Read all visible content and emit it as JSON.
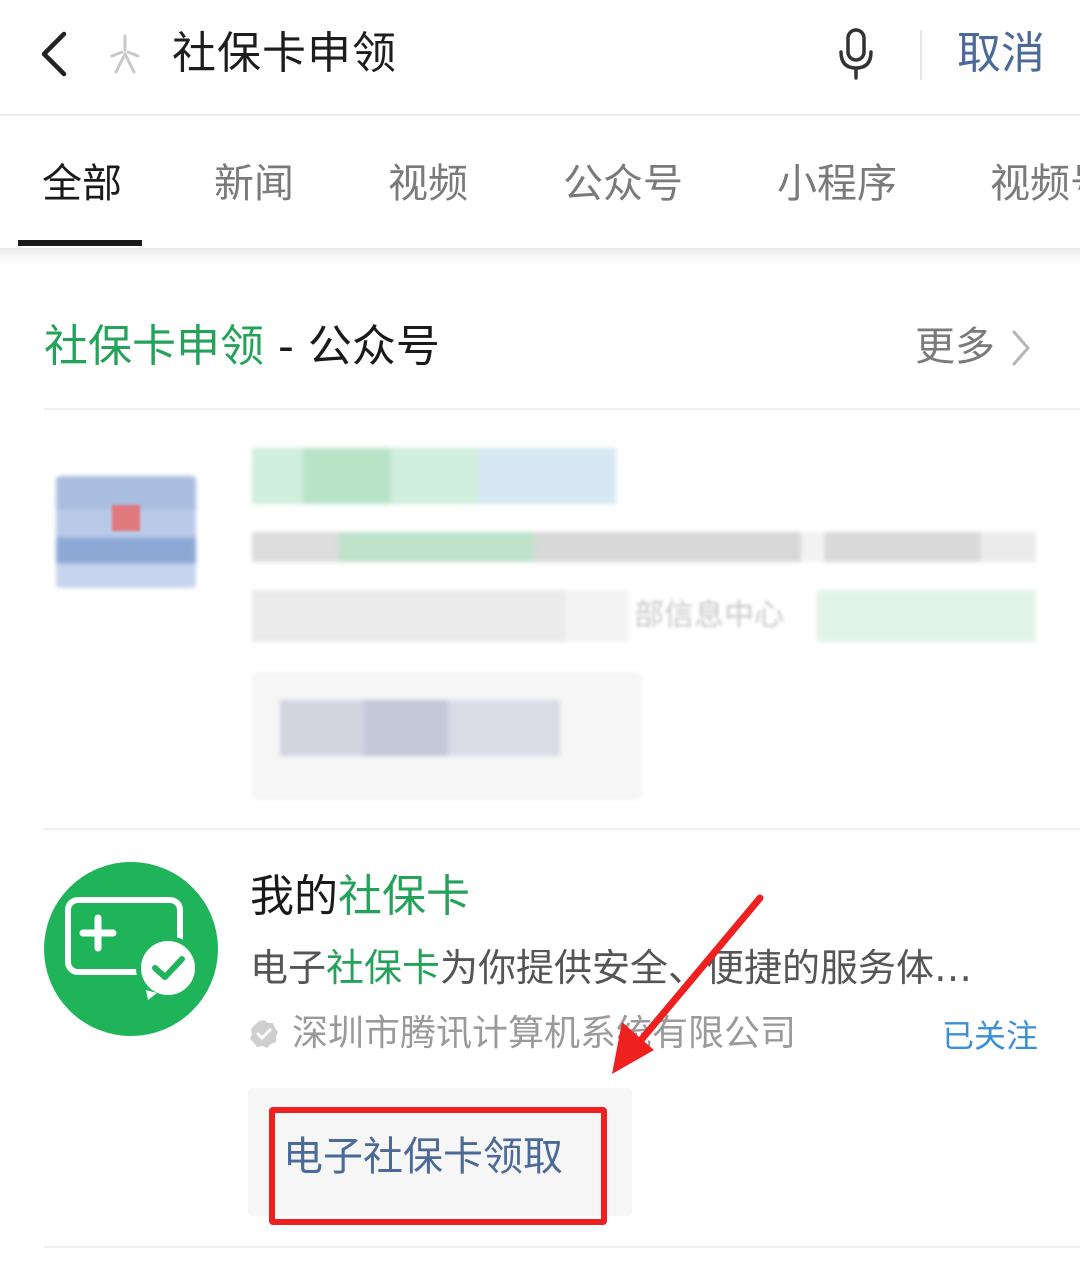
{
  "search_bar": {
    "query": "社保卡申领",
    "cancel_label": "取消"
  },
  "tabs": [
    {
      "label": "全部",
      "active": true
    },
    {
      "label": "新闻",
      "active": false
    },
    {
      "label": "视频",
      "active": false
    },
    {
      "label": "公众号",
      "active": false
    },
    {
      "label": "小程序",
      "active": false
    },
    {
      "label": "视频号",
      "active": false
    }
  ],
  "section": {
    "keyword": "社保卡申领",
    "suffix": " - 公众号",
    "more_label": "更多"
  },
  "blurred_result": {
    "partial_text": "部信息中心"
  },
  "account": {
    "title_prefix": "我的",
    "title_keyword": "社保卡",
    "desc_prefix": "电子",
    "desc_keyword": "社保卡",
    "desc_suffix": "为你提供安全、便捷的服务体…",
    "source": "深圳市腾讯计算机系统有限公司",
    "followed_label": "已关注",
    "service_link": "电子社保卡领取"
  },
  "colors": {
    "keyword_green": "#25a259",
    "link_blue": "#4b6a98",
    "followed_blue": "#3a8fd6",
    "logo_green": "#1fb35a",
    "annotation_red": "#ee2020"
  },
  "icons": [
    "back-icon",
    "search-icon",
    "microphone-icon",
    "chevron-right-icon",
    "verified-icon",
    "card-logo-icon",
    "arrow-annotation"
  ]
}
